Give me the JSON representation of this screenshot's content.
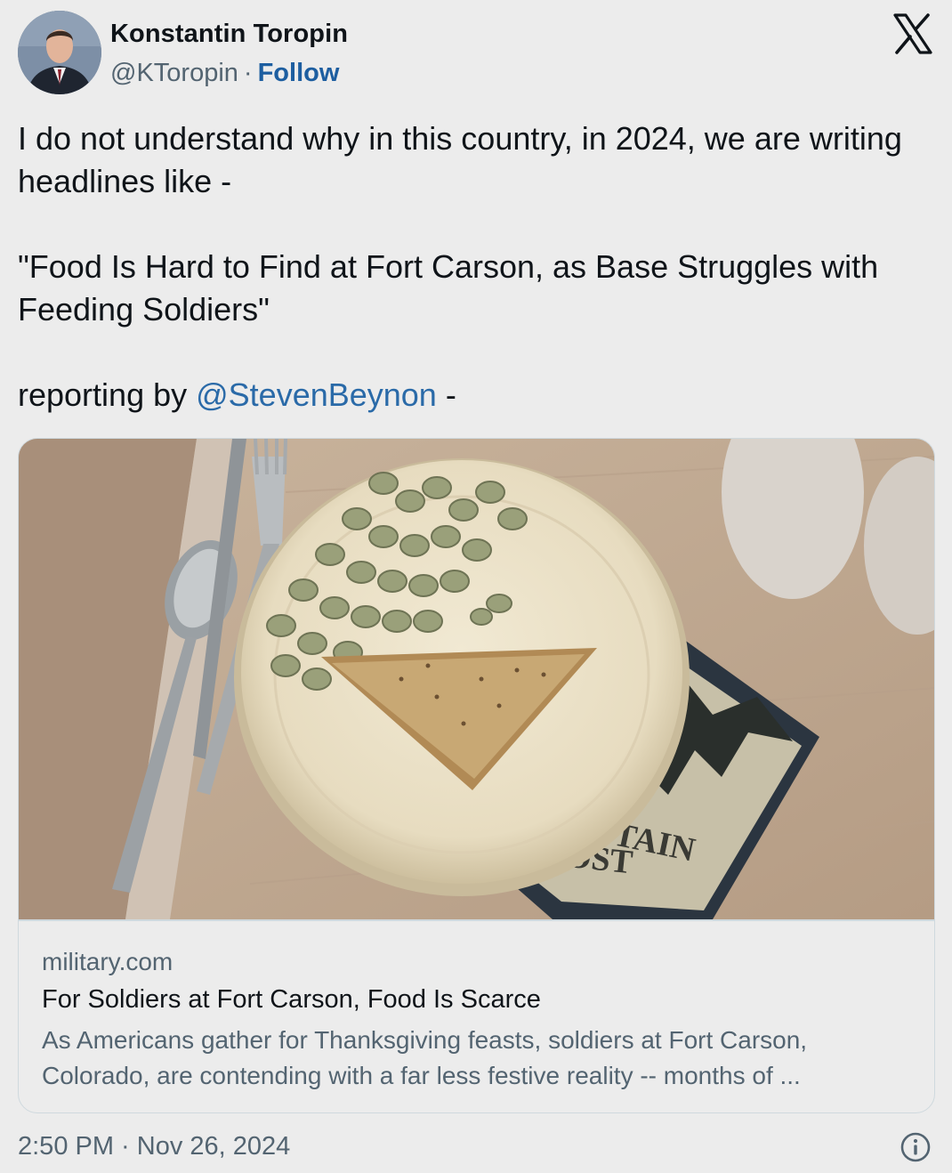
{
  "author": {
    "name": "Konstantin Toropin",
    "handle": "@KToropin",
    "separator": "·",
    "follow_label": "Follow"
  },
  "tweet": {
    "line1": "I do not understand why in this country, in 2024, we are writing headlines like -",
    "line2": "\"Food Is Hard to Find at Fort Carson, as Base Struggles with Feeding Soldiers\"",
    "line3_prefix": "reporting by ",
    "mention": "@StevenBeynon",
    "line3_suffix": " -"
  },
  "card": {
    "domain": "military.com",
    "title": "For Soldiers at Fort Carson, Food Is Scarce",
    "description_line1": "As Americans gather for Thanksgiving feasts, soldiers at Fort Carson,",
    "description_line2": "Colorado, are contending with a far less festive reality -- months of ...",
    "image_mat_text_1": "NTAIN",
    "image_mat_text_2": "POST"
  },
  "footer": {
    "timestamp": "2:50 PM · Nov 26, 2024"
  },
  "icons": {
    "brand": "x-logo-icon",
    "info": "info-icon"
  },
  "colors": {
    "background": "#ececec",
    "link": "#2a6aa8",
    "follow": "#1d5ea0",
    "secondary_text": "#536471",
    "border": "#cfd9de"
  }
}
